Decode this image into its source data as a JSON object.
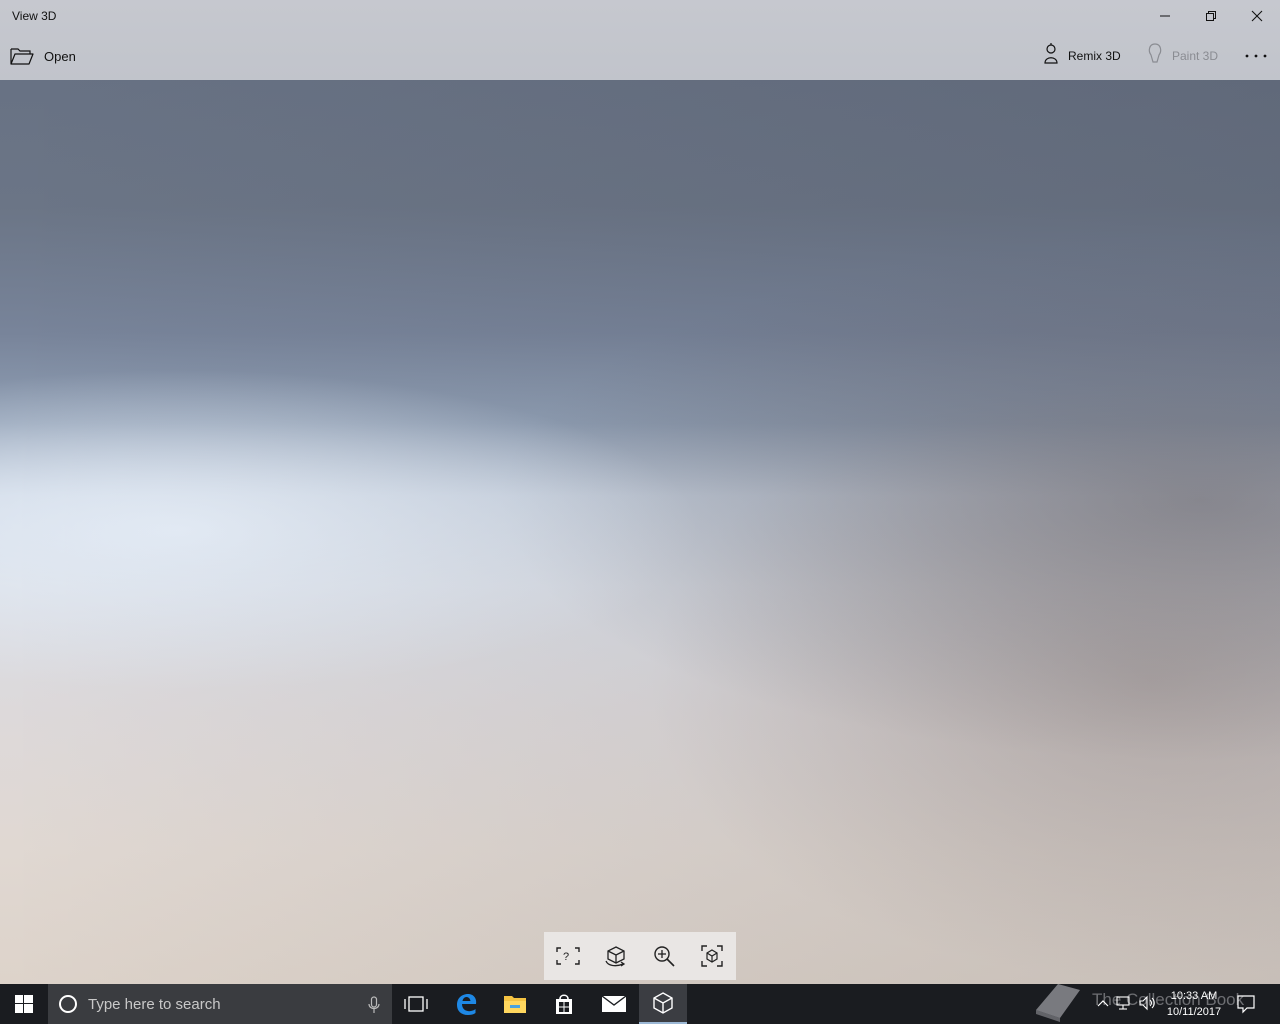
{
  "window": {
    "title": "View 3D",
    "minimize_icon": "minimize-icon",
    "restore_icon": "restore-icon",
    "close_icon": "close-icon"
  },
  "commandbar": {
    "open_label": "Open",
    "open_icon": "folder-open-icon",
    "remix_label": "Remix 3D",
    "remix_icon": "remix-3d-icon",
    "paint_label": "Paint 3D",
    "paint_icon": "paint-3d-icon",
    "paint_enabled": false,
    "more_icon": "more-icon"
  },
  "viewport": {
    "background": "gradient-environment"
  },
  "view_toolbar": {
    "tools": [
      {
        "name": "mixed-reality-tool",
        "icon": "mixed-reality-icon"
      },
      {
        "name": "animation-tool",
        "icon": "animation-icon"
      },
      {
        "name": "zoom-tool",
        "icon": "zoom-in-icon"
      },
      {
        "name": "reset-view-tool",
        "icon": "reset-view-icon"
      }
    ]
  },
  "taskbar": {
    "search_placeholder": "Type here to search",
    "apps": [
      "task-view",
      "edge",
      "file-explorer",
      "store",
      "mail",
      "view-3d"
    ],
    "watermark": "The Collection Book",
    "clock_time": "10:33 AM",
    "clock_date": "10/11/2017",
    "accent": "#0078d7"
  }
}
